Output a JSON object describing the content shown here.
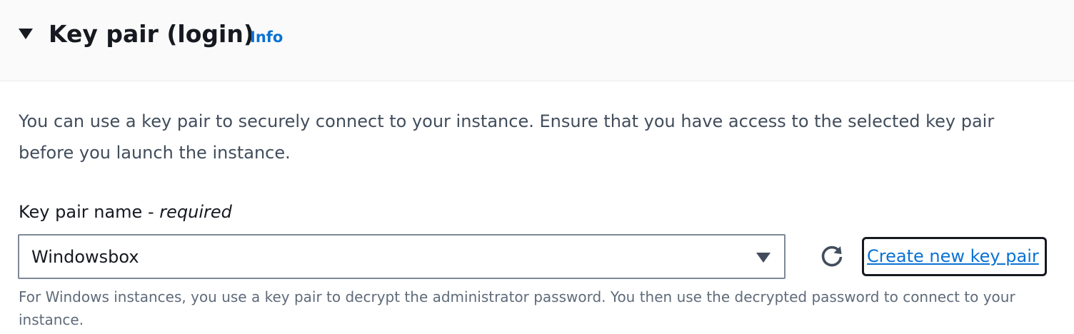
{
  "section": {
    "title": "Key pair (login)",
    "info_link": "Info",
    "expanded": true
  },
  "description": "You can use a key pair to securely connect to your instance. Ensure that you have access to the selected key pair before you launch the instance.",
  "field": {
    "label": "Key pair name - ",
    "required_label": "required",
    "selected_value": "Windowsbox",
    "refresh_icon": "refresh-icon",
    "create_link": "Create new key pair",
    "help_text": "For Windows instances, you use a key pair to decrypt the administrator password. You then use the decrypted password to connect to your instance."
  },
  "colors": {
    "link": "#0972d3",
    "text": "#16191f",
    "secondary_text": "#414d5c",
    "help_text": "#5f6b7a",
    "header_bg": "#fafafa",
    "border": "#7d8998"
  }
}
